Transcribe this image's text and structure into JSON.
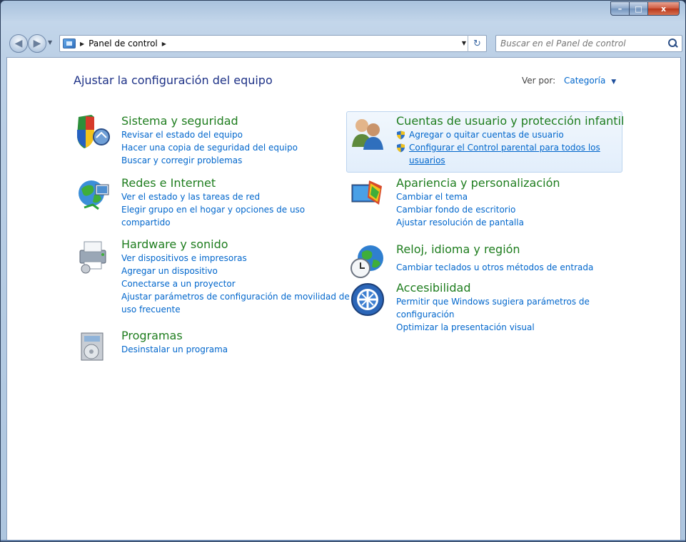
{
  "window": {
    "caption_min": "–",
    "caption_max": "□",
    "caption_close": "x"
  },
  "navbar": {
    "breadcrumb": "Panel de control",
    "search_placeholder": "Buscar en el Panel de control"
  },
  "header": {
    "title": "Ajustar la configuración del equipo",
    "viewby_label": "Ver por:",
    "viewby_value": "Categoría"
  },
  "categories": {
    "sistema": {
      "title": "Sistema y seguridad",
      "links": [
        "Revisar el estado del equipo",
        "Hacer una copia de seguridad del equipo",
        "Buscar y corregir problemas"
      ]
    },
    "redes": {
      "title": "Redes e Internet",
      "links": [
        "Ver el estado y las tareas de red",
        "Elegir grupo en el hogar y opciones de uso compartido"
      ]
    },
    "hardware": {
      "title": "Hardware y sonido",
      "links": [
        "Ver dispositivos e impresoras",
        "Agregar un dispositivo",
        "Conectarse a un proyector",
        "Ajustar parámetros de configuración de movilidad de uso frecuente"
      ]
    },
    "programas": {
      "title": "Programas",
      "links": [
        "Desinstalar un programa"
      ]
    },
    "cuentas": {
      "title": "Cuentas de usuario y protección infantil",
      "links": [
        "Agregar o quitar cuentas de usuario",
        "Configurar el Control parental para todos los usuarios"
      ]
    },
    "apariencia": {
      "title": "Apariencia y personalización",
      "links": [
        "Cambiar el tema",
        "Cambiar fondo de escritorio",
        "Ajustar resolución de pantalla"
      ]
    },
    "reloj": {
      "title": "Reloj, idioma y región",
      "links": [
        "Cambiar teclados u otros métodos de entrada"
      ]
    },
    "accesibilidad": {
      "title": "Accesibilidad",
      "links": [
        "Permitir que Windows sugiera parámetros de configuración",
        "Optimizar la presentación visual"
      ]
    }
  }
}
